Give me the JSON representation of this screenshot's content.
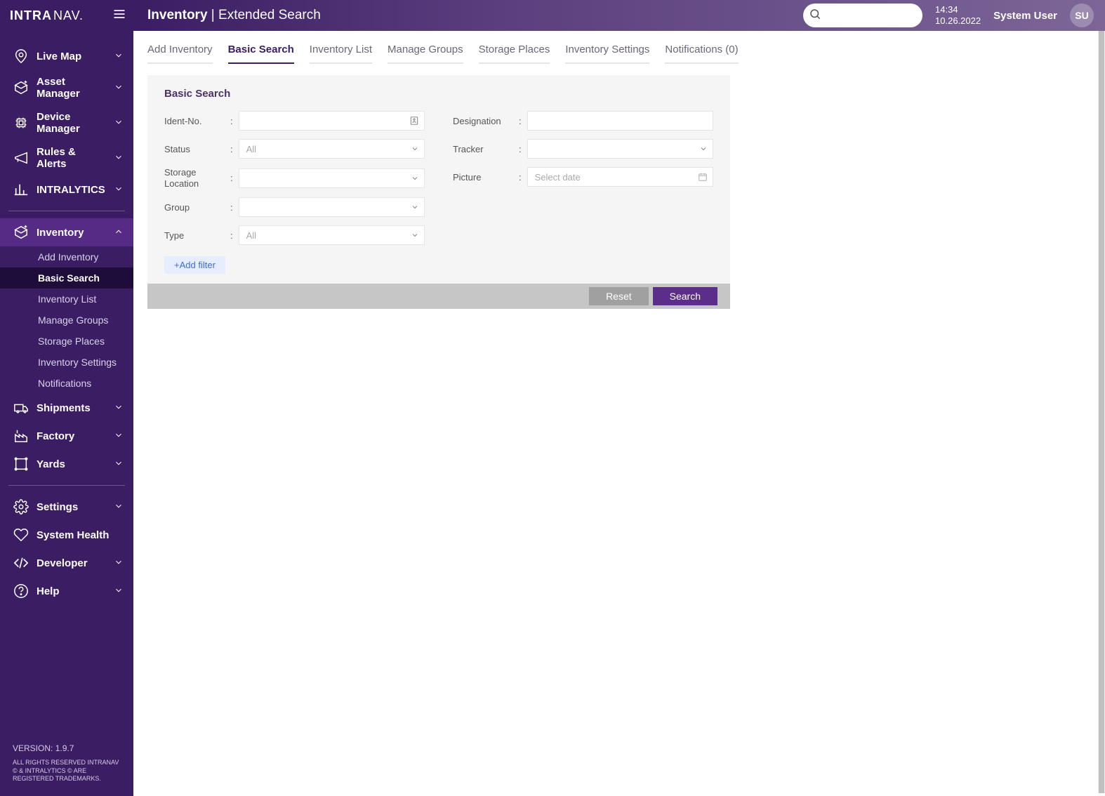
{
  "brand": {
    "main": "INTRA",
    "sub": "NAV."
  },
  "header": {
    "crumb_main": "Inventory",
    "crumb_sep": " | ",
    "crumb_sub": "Extended Search",
    "time": "14:34",
    "date": "10.26.2022",
    "user": "System User",
    "avatar_initials": "SU",
    "search_placeholder": ""
  },
  "sidebar": {
    "groups": [
      {
        "items": [
          {
            "label": "Live Map",
            "icon": "pin"
          },
          {
            "label": "Asset Manager",
            "icon": "box-plus"
          },
          {
            "label": "Device Manager",
            "icon": "chip"
          },
          {
            "label": "Rules & Alerts",
            "icon": "megaphone"
          },
          {
            "label": "INTRALYTICS",
            "icon": "bars"
          }
        ]
      },
      {
        "items": [
          {
            "label": "Inventory",
            "icon": "box-plus",
            "expanded": true,
            "children": [
              {
                "label": "Add Inventory"
              },
              {
                "label": "Basic Search",
                "active": true
              },
              {
                "label": "Inventory List"
              },
              {
                "label": "Manage Groups"
              },
              {
                "label": "Storage Places"
              },
              {
                "label": "Inventory Settings"
              },
              {
                "label": "Notifications"
              }
            ]
          },
          {
            "label": "Shipments",
            "icon": "truck"
          },
          {
            "label": "Factory",
            "icon": "factory"
          },
          {
            "label": "Yards",
            "icon": "yard"
          }
        ]
      },
      {
        "items": [
          {
            "label": "Settings",
            "icon": "gear"
          },
          {
            "label": "System Health",
            "icon": "heart"
          },
          {
            "label": "Developer",
            "icon": "code"
          },
          {
            "label": "Help",
            "icon": "help"
          }
        ]
      }
    ],
    "version_label": "VERSION:",
    "version": "1.9.7",
    "legal": "ALL RIGHTS RESERVED INTRANAV © & INTRALYTICS © ARE REGISTERED TRADEMARKS."
  },
  "tabs": [
    {
      "label": "Add Inventory"
    },
    {
      "label": "Basic Search",
      "active": true
    },
    {
      "label": "Inventory List"
    },
    {
      "label": "Manage Groups"
    },
    {
      "label": "Storage Places"
    },
    {
      "label": "Inventory Settings"
    },
    {
      "label": "Notifications (0)"
    }
  ],
  "panel": {
    "title": "Basic Search",
    "left": {
      "ident_label": "Ident-No.",
      "status_label": "Status",
      "status_placeholder": "All",
      "storage_label": "Storage Location",
      "group_label": "Group",
      "type_label": "Type",
      "type_placeholder": "All"
    },
    "right": {
      "designation_label": "Designation",
      "tracker_label": "Tracker",
      "picture_label": "Picture",
      "picture_placeholder": "Select date"
    },
    "add_filter": "+Add filter",
    "reset": "Reset",
    "search": "Search"
  }
}
